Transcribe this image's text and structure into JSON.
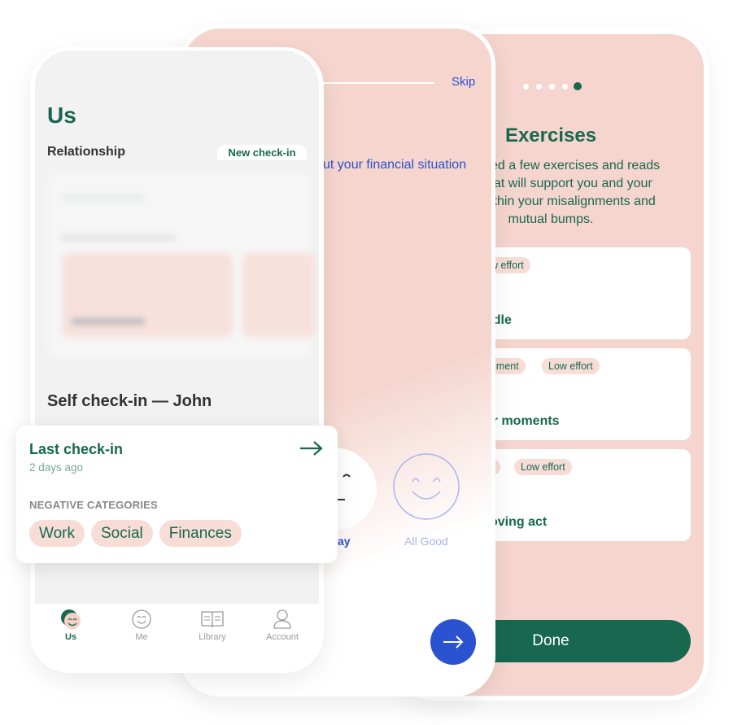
{
  "colors": {
    "brand_green": "#17684f",
    "blush": "#f5d5ce",
    "accent_blue": "#2a52d1"
  },
  "exercises_screen": {
    "pagination": {
      "total": 5,
      "active": 5
    },
    "title": "Exercises",
    "description_lines": [
      "ed a few exercises and reads",
      "at will support you and your",
      "ithin your misalignments and",
      "mutual bumps."
    ],
    "cards": [
      {
        "tags": [
          "ow effort"
        ],
        "title": "ddle"
      },
      {
        "tags": [
          "gement",
          "Low effort"
        ],
        "title": "ur moments"
      },
      {
        "tags": [
          "n",
          "Low effort"
        ],
        "title": "oving act"
      }
    ],
    "done_label": "Done"
  },
  "checkin_screen": {
    "skip_label": "Skip",
    "question_fragment": "ut your financial situation",
    "mood_options": [
      {
        "label": "ay",
        "icon": "neutral-face-icon"
      },
      {
        "label": "All Good",
        "icon": "smile-face-icon"
      }
    ],
    "next_icon": "arrow-right-icon"
  },
  "us_screen": {
    "title": "Us",
    "relationship_label": "Relationship",
    "new_checkin_label": "New check-in",
    "self_checkin_title": "Self check-in — John",
    "tabs": [
      {
        "label": "Us",
        "icon": "us-avatar-icon",
        "active": true
      },
      {
        "label": "Me",
        "icon": "smile-icon",
        "active": false
      },
      {
        "label": "Library",
        "icon": "book-icon",
        "active": false
      },
      {
        "label": "Account",
        "icon": "person-icon",
        "active": false
      }
    ]
  },
  "last_checkin_card": {
    "title": "Last check-in",
    "time": "2 days ago",
    "section_label": "NEGATIVE CATEGORIES",
    "categories": [
      "Work",
      "Social",
      "Finances"
    ]
  }
}
